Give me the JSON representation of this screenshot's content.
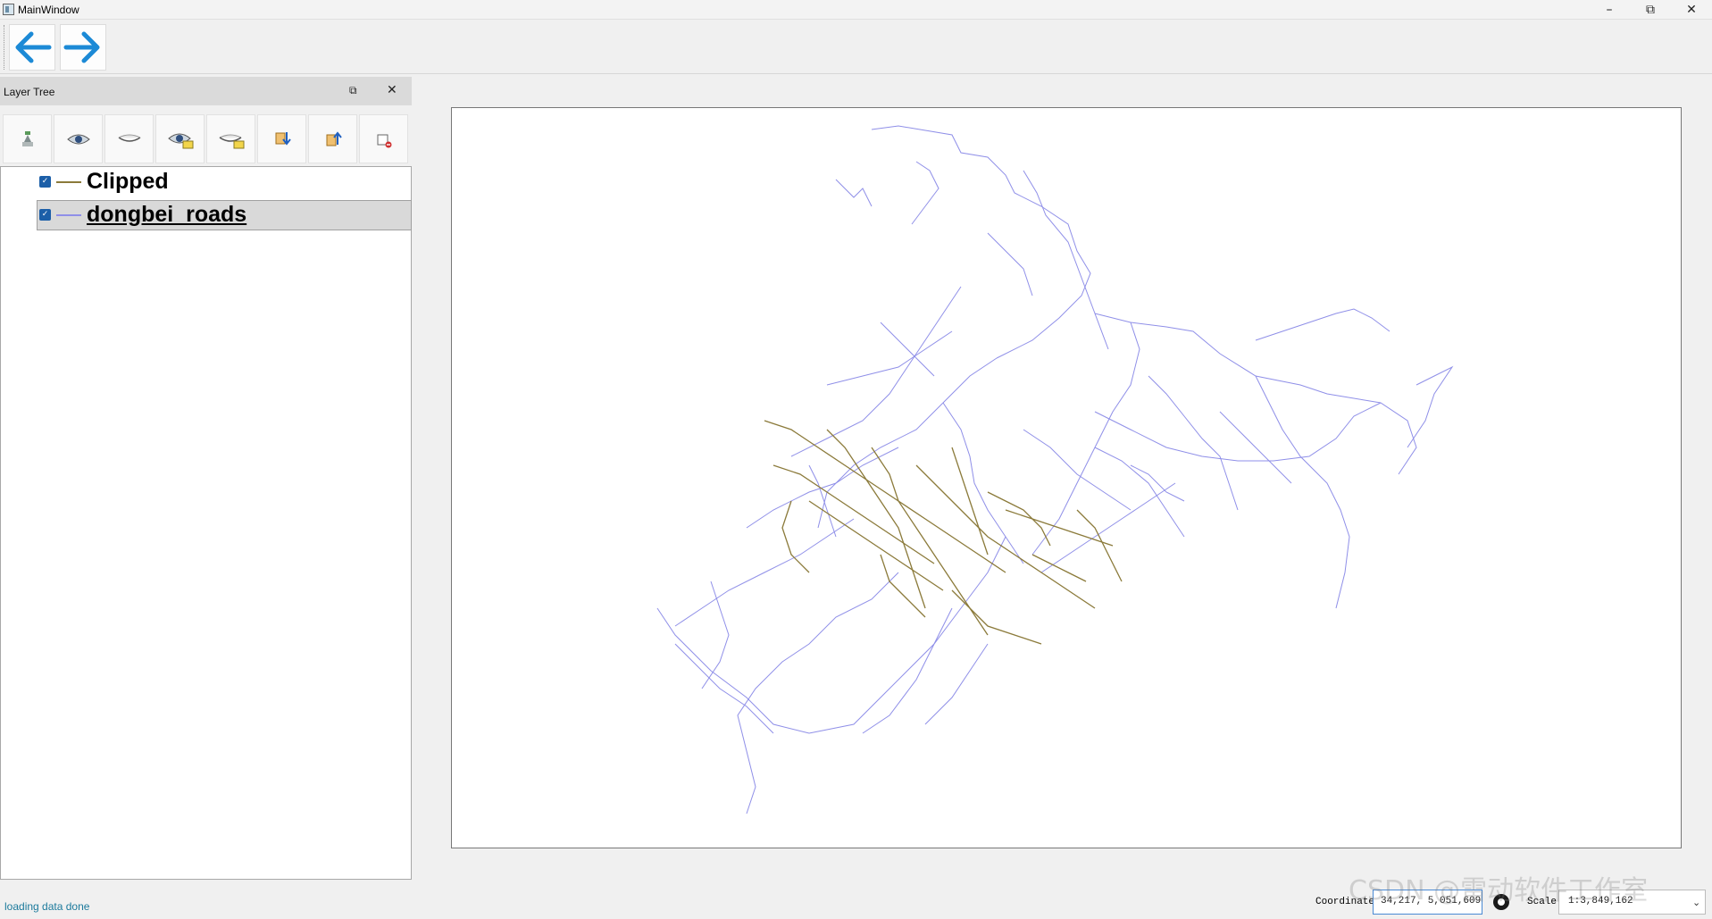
{
  "window": {
    "title": "MainWindow"
  },
  "dock": {
    "title": "Layer Tree"
  },
  "layers": [
    {
      "name": "Clipped",
      "checked": true,
      "color": "#8b7a3a",
      "selected": false
    },
    {
      "name": "dongbei_roads",
      "checked": true,
      "color": "#8f8fe8",
      "selected": true
    }
  ],
  "toolbar_icons": [
    "add-layer-icon",
    "show-layer-icon",
    "hide-layer-icon",
    "show-selected-icon",
    "hide-selected-icon",
    "move-layer-down-icon",
    "move-layer-up-icon",
    "remove-layer-icon"
  ],
  "status": {
    "message": "loading data done",
    "coordinate_label": "Coordinate",
    "coordinate_value": "34,217, 5,051,609",
    "scale_label": "Scale",
    "scale_value": "1:3,849,162"
  },
  "watermark": "CSDN @雷动软件工作室",
  "colors": {
    "accent": "#1c8ad6",
    "clipped_layer": "#8b7a3a",
    "roads_layer": "#8f8fe8",
    "status_text": "#1c7a9c"
  }
}
